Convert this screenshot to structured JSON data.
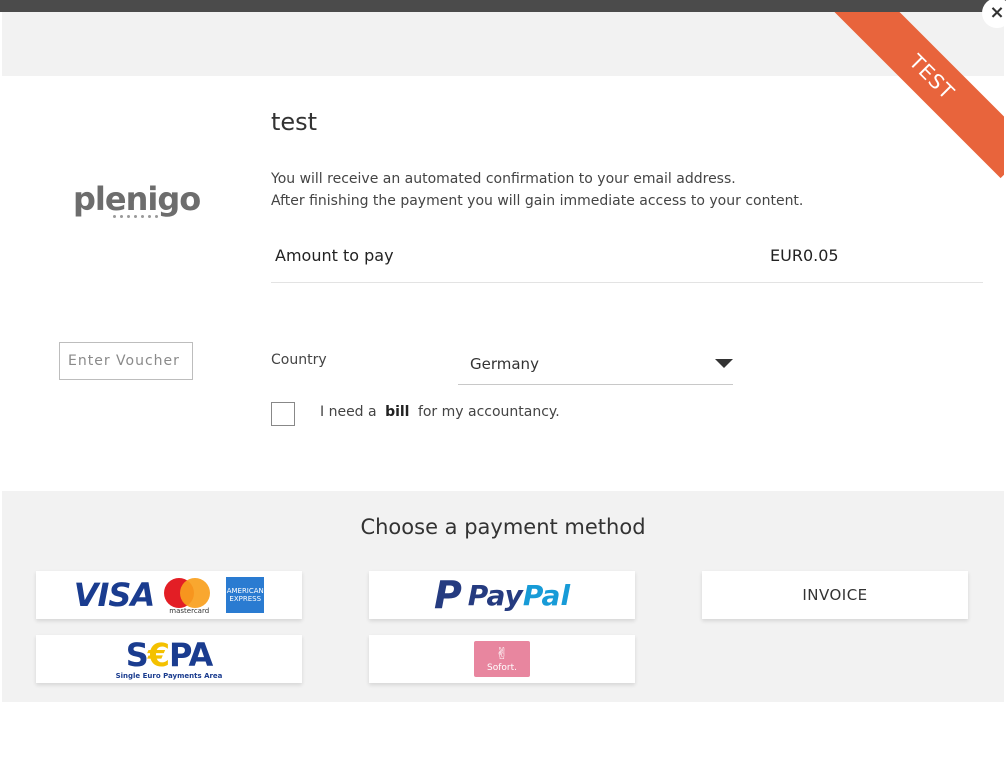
{
  "ribbon": {
    "label": "TEST",
    "color": "#e8643c"
  },
  "close": {
    "label": "×"
  },
  "logo": {
    "text": "plenigo"
  },
  "product": {
    "title": "test",
    "info_line1": "You will receive an automated confirmation to your email address.",
    "info_line2": "After finishing the payment you will gain immediate access to your content."
  },
  "amount": {
    "label": "Amount to pay",
    "value": "EUR0.05"
  },
  "voucher": {
    "placeholder": "Enter Voucher"
  },
  "country": {
    "label": "Country",
    "selected": "Germany"
  },
  "bill": {
    "text_before": "I need a",
    "bold": "bill",
    "text_after": "for my accountancy.",
    "checked": false
  },
  "payment": {
    "title": "Choose a payment method",
    "methods": {
      "cards": {
        "visa": "VISA",
        "mastercard": "mastercard",
        "amex": "AMERICAN EXPRESS"
      },
      "paypal": {
        "p": "P",
        "part1": "Pay",
        "part2": "Pal"
      },
      "invoice": "INVOICE",
      "sepa": {
        "text_s": "S",
        "text_euro": "€",
        "text_pa": "PA",
        "sub": "Single Euro Payments Area"
      },
      "sofort": {
        "hand": "✌",
        "label": "Sofort."
      }
    }
  },
  "colors": {
    "paypal_dark": "#253b80",
    "paypal_light": "#179bd7",
    "visa_blue": "#1a3c8f",
    "sofort_pink": "#e8869f"
  }
}
